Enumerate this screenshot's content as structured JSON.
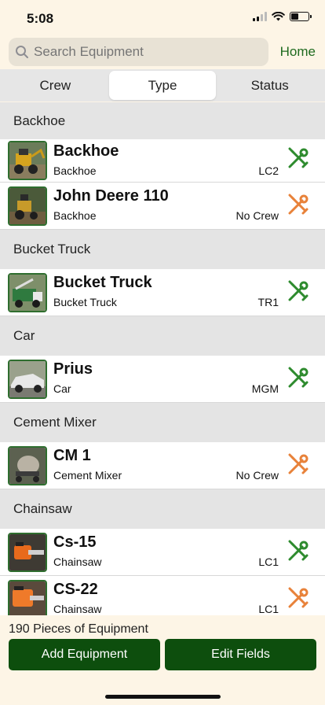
{
  "status": {
    "time": "5:08"
  },
  "search": {
    "placeholder": "Search Equipment"
  },
  "home_label": "Home",
  "tabs": [
    {
      "label": "Crew",
      "active": false
    },
    {
      "label": "Type",
      "active": true
    },
    {
      "label": "Status",
      "active": false
    }
  ],
  "sections": [
    {
      "title": "Backhoe",
      "items": [
        {
          "name": "Backhoe",
          "type": "Backhoe",
          "crew": "LC2",
          "tool_status": "green"
        },
        {
          "name": "John Deere 110",
          "type": "Backhoe",
          "crew": "No Crew",
          "tool_status": "orange"
        }
      ]
    },
    {
      "title": "Bucket Truck",
      "items": [
        {
          "name": "Bucket Truck",
          "type": "Bucket Truck",
          "crew": "TR1",
          "tool_status": "green"
        }
      ]
    },
    {
      "title": "Car",
      "items": [
        {
          "name": "Prius",
          "type": "Car",
          "crew": "MGM",
          "tool_status": "green"
        }
      ]
    },
    {
      "title": "Cement Mixer",
      "items": [
        {
          "name": "CM 1",
          "type": "Cement Mixer",
          "crew": "No Crew",
          "tool_status": "orange"
        }
      ]
    },
    {
      "title": "Chainsaw",
      "items": [
        {
          "name": "Cs-15",
          "type": "Chainsaw",
          "crew": "LC1",
          "tool_status": "green"
        },
        {
          "name": "CS-22",
          "type": "Chainsaw",
          "crew": "LC1",
          "tool_status": "orange"
        }
      ]
    }
  ],
  "footer": {
    "count_text": "190 Pieces of Equipment",
    "add_label": "Add Equipment",
    "edit_label": "Edit Fields"
  },
  "colors": {
    "green": "#2e8b2e",
    "orange": "#e8823a",
    "button": "#0d4e0d",
    "background": "#fdf5e6"
  },
  "icons": {
    "search": "search-icon",
    "tool": "wrench-screwdriver-icon"
  }
}
